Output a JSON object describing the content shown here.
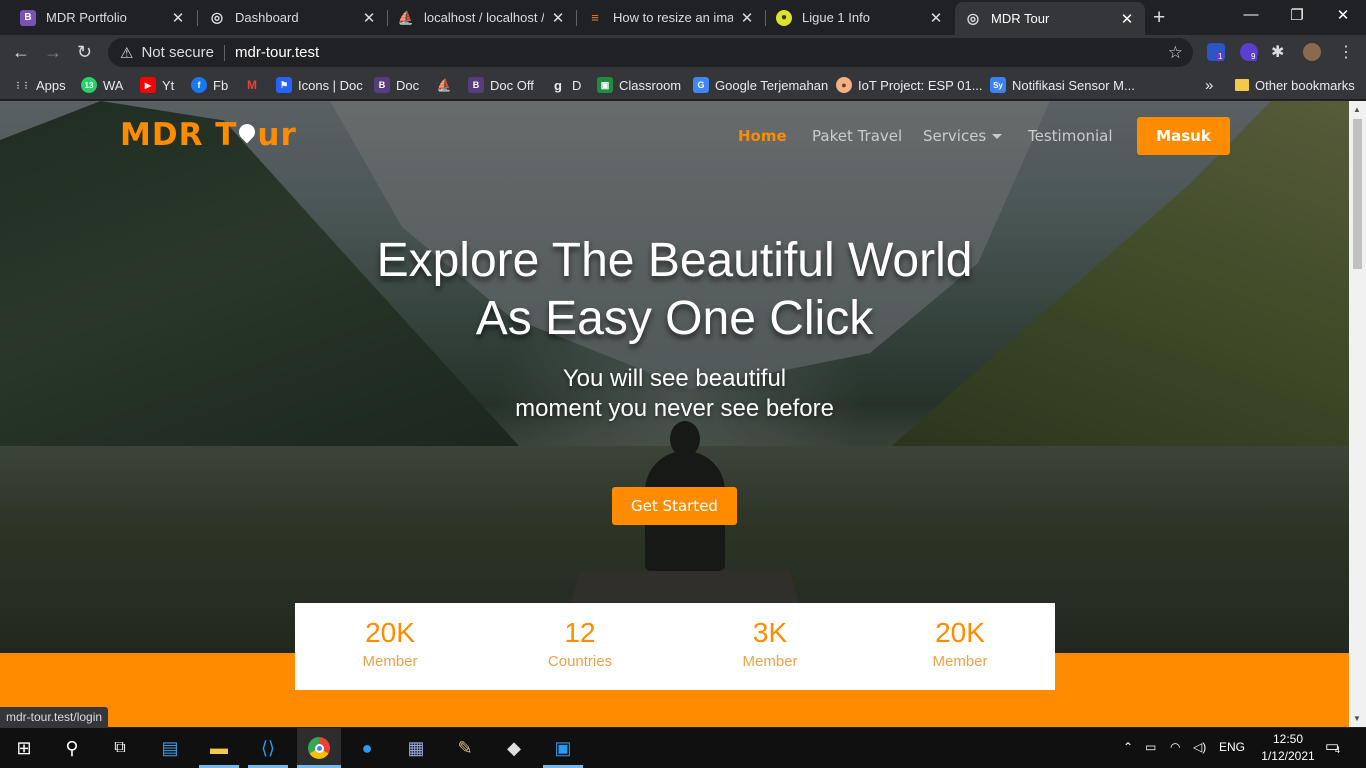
{
  "browser": {
    "tabs": [
      {
        "title": "MDR Portfolio",
        "icon": "bootstrap-icon",
        "color": "#7952b3",
        "glyph": "B"
      },
      {
        "title": "Dashboard",
        "icon": "globe-icon",
        "color": "#dadce0",
        "glyph": "◎"
      },
      {
        "title": "localhost / localhost / d",
        "icon": "phpmyadmin-icon",
        "color": "#f29111",
        "glyph": "⛵"
      },
      {
        "title": "How to resize an image",
        "icon": "stackoverflow-icon",
        "color": "#f48024",
        "glyph": "≡"
      },
      {
        "title": "Ligue 1 Info",
        "icon": "ligue1-icon",
        "color": "#dbe32a",
        "glyph": "●"
      },
      {
        "title": "MDR Tour",
        "icon": "globe-icon",
        "color": "#dadce0",
        "glyph": "◎",
        "active": true
      }
    ],
    "new_tab": "+",
    "window": {
      "minimize": "—",
      "restore": "❐",
      "close": "✕"
    },
    "address": {
      "security": "Not secure",
      "url": "mdr-tour.test"
    },
    "bookmarks": [
      {
        "label": "Apps",
        "icon": "apps-grid-icon",
        "color": "#e8eaed",
        "glyph": "⋮⋮"
      },
      {
        "label": "WA",
        "icon": "whatsapp-icon",
        "color": "#25d366",
        "glyph": "13"
      },
      {
        "label": "Yt",
        "icon": "youtube-icon",
        "color": "#ff0000",
        "glyph": "▶"
      },
      {
        "label": "Fb",
        "icon": "facebook-icon",
        "color": "#1877f2",
        "glyph": "f"
      },
      {
        "label": "",
        "icon": "gmail-icon",
        "color": "#ea4335",
        "glyph": "M"
      },
      {
        "label": "Icons | Doc",
        "icon": "flag-icon",
        "color": "#2962ff",
        "glyph": "⚑"
      },
      {
        "label": "Doc",
        "icon": "bootstrap-icon",
        "color": "#563d7c",
        "glyph": "B"
      },
      {
        "label": "",
        "icon": "phpmyadmin-icon",
        "color": "#f29111",
        "glyph": "⛵"
      },
      {
        "label": "Doc Off",
        "icon": "bootstrap-icon",
        "color": "#563d7c",
        "glyph": "B"
      },
      {
        "label": "D",
        "icon": "gh-icon",
        "color": "#e8eaed",
        "glyph": "g"
      },
      {
        "label": "Classroom",
        "icon": "classroom-icon",
        "color": "#1e8e3e",
        "glyph": "▣"
      },
      {
        "label": "Google Terjemahan",
        "icon": "translate-icon",
        "color": "#4285f4",
        "glyph": "G"
      },
      {
        "label": "IoT Project: ESP 01...",
        "icon": "iot-icon",
        "color": "#f4b183",
        "glyph": "●"
      },
      {
        "label": "Notifikasi Sensor M...",
        "icon": "sy-icon",
        "color": "#3b82f6",
        "glyph": "Sy"
      }
    ],
    "bookmarks_more": "»",
    "other_bookmarks": "Other bookmarks",
    "extension_badges": [
      "1",
      "9"
    ]
  },
  "site": {
    "logo_part1": "MDR T",
    "logo_part2": "ur",
    "nav": [
      "Home",
      "Paket Travel",
      "Services",
      "Testimonial"
    ],
    "login_button": "Masuk",
    "hero_title_line1": "Explore The Beautiful World",
    "hero_title_line2": "As Easy One Click",
    "hero_sub_line1": "You will see beautiful",
    "hero_sub_line2": "moment you never see before",
    "cta": "Get Started",
    "stats": [
      {
        "value": "20K",
        "label": "Member"
      },
      {
        "value": "12",
        "label": "Countries"
      },
      {
        "value": "3K",
        "label": "Member"
      },
      {
        "value": "20K",
        "label": "Member"
      }
    ]
  },
  "status_url": "mdr-tour.test/login",
  "taskbar": {
    "language": "ENG",
    "time": "12:50",
    "date": "1/12/2021",
    "notifications": "4"
  }
}
